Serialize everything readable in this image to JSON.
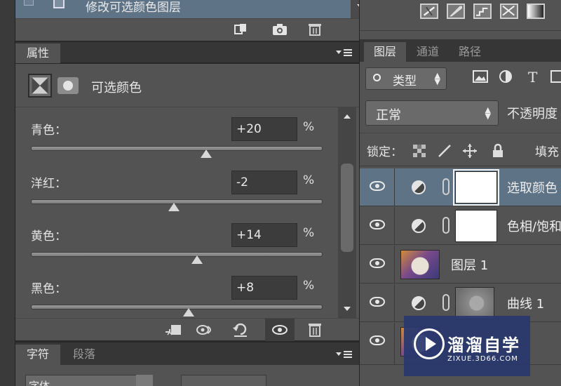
{
  "history": {
    "item_label": "修改可选颜色图层"
  },
  "properties": {
    "tab_label": "属性",
    "title": "可选颜色",
    "adjustments": [
      {
        "label": "青色：",
        "value": "+20",
        "unit": "%",
        "slider_fraction": 0.6
      },
      {
        "label": "洋红：",
        "value": "-2",
        "unit": "%",
        "slider_fraction": 0.49
      },
      {
        "label": "黄色：",
        "value": "+14",
        "unit": "%",
        "slider_fraction": 0.57
      },
      {
        "label": "黑色：",
        "value": "+8",
        "unit": "%",
        "slider_fraction": 0.54
      }
    ]
  },
  "character": {
    "tab_label": "字符",
    "paragraph_tab_label": "段落",
    "font_select_value": "字体"
  },
  "layers": {
    "tabs": [
      "图层",
      "通道",
      "路径"
    ],
    "filter_value": "类型",
    "blend_mode": "正常",
    "opacity_label": "不透明度",
    "lock_label": "锁定：",
    "fill_label": "填充",
    "rows": [
      {
        "name": "选取颜色",
        "kind": "adjustment",
        "selected": true
      },
      {
        "name": "色相/饱和",
        "kind": "adjustment",
        "selected": false
      },
      {
        "name": "图层 1",
        "kind": "image",
        "selected": false
      },
      {
        "name": "曲线 1",
        "kind": "adjustment-curve",
        "selected": false
      }
    ]
  },
  "watermark": {
    "name": "溜溜自学",
    "url": "ZIXUE.3D66.COM"
  },
  "colors": {
    "panel": "#535353",
    "selection": "#5f7387",
    "watermark": "#28376e"
  }
}
